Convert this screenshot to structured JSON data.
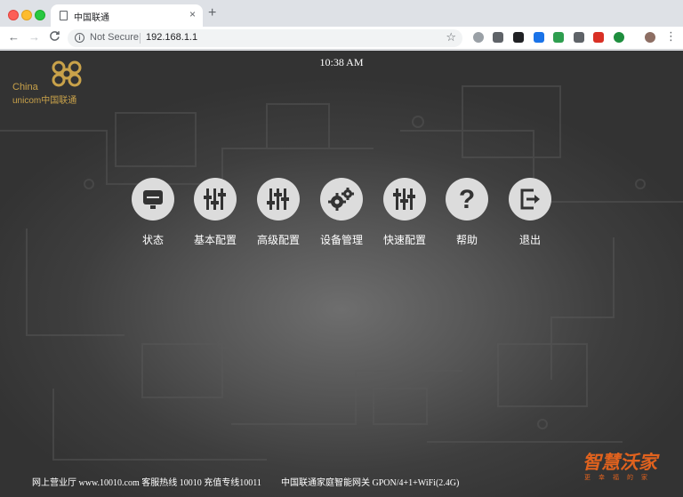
{
  "browser": {
    "tab_title": "中国联通",
    "tab_close": "×",
    "new_tab": "+",
    "back": "←",
    "forward": "→",
    "reload": "C",
    "security_label": "Not Secure",
    "url": "192.168.1.1",
    "star": "☆",
    "menu_dots": "⋮",
    "extensions": [
      {
        "name": "circle-extension-icon",
        "color": "#9aa0a6"
      },
      {
        "name": "s-extension-icon",
        "color": "#5f6368"
      },
      {
        "name": "square-extension-icon",
        "color": "#202124"
      },
      {
        "name": "password-extension-icon",
        "color": "#1a73e8"
      },
      {
        "name": "shield-extension-icon",
        "color": "#2e9e4f"
      },
      {
        "name": "gear-extension-icon",
        "color": "#5f6368"
      },
      {
        "name": "red-extension-icon",
        "color": "#d93025"
      },
      {
        "name": "green-extension-icon",
        "color": "#1e8e3e"
      },
      {
        "name": "avatar-icon",
        "color": "#8d6e63"
      }
    ]
  },
  "header": {
    "logo_text_1": "China",
    "logo_text_2": "unicom中国联通",
    "time": "10:38 AM"
  },
  "menu": {
    "items": [
      {
        "label": "状态",
        "icon": "monitor-icon"
      },
      {
        "label": "基本配置",
        "icon": "sliders-icon"
      },
      {
        "label": "高级配置",
        "icon": "sliders-advanced-icon"
      },
      {
        "label": "设备管理",
        "icon": "gears-icon"
      },
      {
        "label": "快速配置",
        "icon": "sliders-quick-icon"
      },
      {
        "label": "帮助",
        "icon": "question-icon"
      },
      {
        "label": "退出",
        "icon": "logout-icon"
      }
    ]
  },
  "footer": {
    "left": "网上营业厅 www.10010.com 客服热线 10010 充值专线10011",
    "right": "中国联通家庭智能网关 GPON/4+1+WiFi(2.4G)",
    "brand_main": "智慧沃家",
    "brand_sub": "更幸福的家"
  },
  "colors": {
    "accent": "#e0621e",
    "logo_gold": "#c9a24a"
  }
}
